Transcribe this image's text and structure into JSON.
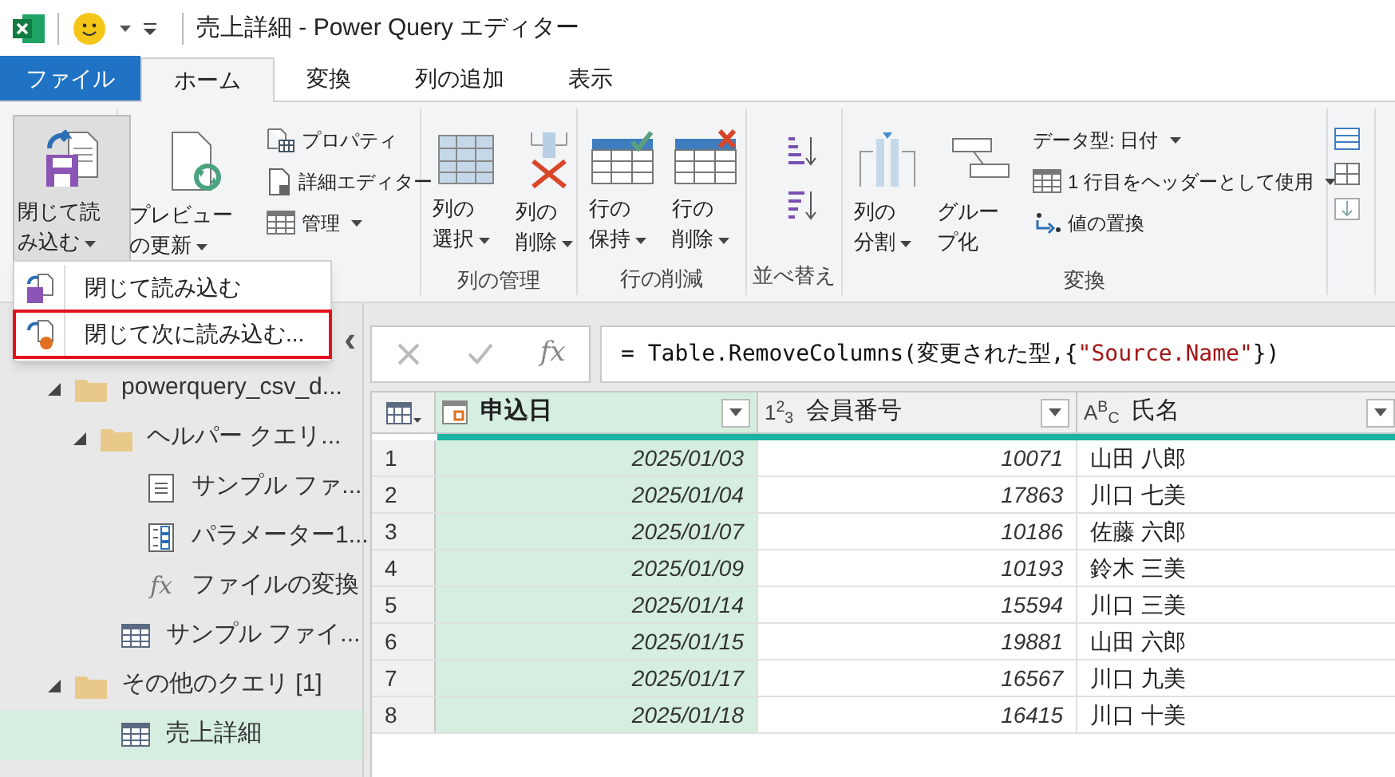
{
  "window": {
    "title": "売上詳細 - Power Query エディター"
  },
  "tabs": [
    {
      "label": "ファイル",
      "kind": "file",
      "selected": false
    },
    {
      "label": "ホーム",
      "kind": "tab",
      "selected": true
    },
    {
      "label": "変換",
      "kind": "tab",
      "selected": false
    },
    {
      "label": "列の追加",
      "kind": "tab",
      "selected": false
    },
    {
      "label": "表示",
      "kind": "tab",
      "selected": false
    }
  ],
  "ribbon": {
    "groups": [
      {
        "items": [
          {
            "kind": "large",
            "label": "閉じて読み込む",
            "dropdown": true,
            "pressed": true
          }
        ]
      },
      {
        "items": [
          {
            "kind": "large",
            "label": "プレビューの更新",
            "dropdown": true,
            "pressed": false
          },
          {
            "kind": "stack",
            "entries": [
              {
                "label": "プロパティ",
                "dropdown": false
              },
              {
                "label": "詳細エディター",
                "dropdown": false
              },
              {
                "label": "管理",
                "dropdown": true
              }
            ]
          }
        ]
      },
      {
        "label": "列の管理",
        "items": [
          {
            "kind": "large",
            "label": "列の選択",
            "dropdown": true,
            "pressed": false
          },
          {
            "kind": "large",
            "label": "列の削除",
            "dropdown": true,
            "pressed": false
          }
        ]
      },
      {
        "label": "行の削減",
        "items": [
          {
            "kind": "large",
            "label": "行の保持",
            "dropdown": true,
            "pressed": false
          },
          {
            "kind": "large",
            "label": "行の削除",
            "dropdown": true,
            "pressed": false
          }
        ]
      },
      {
        "label": "並べ替え",
        "items": [
          {
            "kind": "sort"
          }
        ]
      },
      {
        "label": "変換",
        "items": [
          {
            "kind": "large",
            "label": "列の分割",
            "dropdown": true,
            "pressed": false
          },
          {
            "kind": "large",
            "label": "グループ化",
            "dropdown": false,
            "pressed": false
          },
          {
            "kind": "stack",
            "entries": [
              {
                "label": "データ型: 日付",
                "dropdown": true
              },
              {
                "label": "1 行目をヘッダーとして使用",
                "dropdown": true
              },
              {
                "label": "値の置換",
                "dropdown": false
              }
            ]
          }
        ]
      },
      {
        "items": [
          {
            "kind": "partial"
          }
        ]
      }
    ]
  },
  "load_menu": {
    "items": [
      {
        "label": "閉じて読み込む",
        "highlighted": false
      },
      {
        "label": "閉じて次に読み込む...",
        "highlighted": true
      }
    ]
  },
  "queries_pane": {
    "collapse": "‹",
    "tree": [
      {
        "kind": "folder",
        "label": "powerquery_csv_d...",
        "expanded": true,
        "selected": false,
        "children": [
          {
            "kind": "folder",
            "label": "ヘルパー クエリ...",
            "expanded": true,
            "selected": false,
            "children": [
              {
                "kind": "list",
                "label": "サンプル ファ...",
                "selected": false
              },
              {
                "kind": "parameter",
                "label": "パラメーター1...",
                "selected": false
              },
              {
                "kind": "function",
                "icon_text": "fx",
                "label": "ファイルの変換",
                "selected": false
              }
            ]
          },
          {
            "kind": "table",
            "label": "サンプル ファイ...",
            "selected": false
          }
        ]
      },
      {
        "kind": "folder",
        "label": "その他のクエリ [1]",
        "expanded": true,
        "selected": false,
        "children": [
          {
            "kind": "table",
            "label": "売上詳細",
            "selected": true
          }
        ]
      }
    ]
  },
  "formula_bar": {
    "fx": "fx",
    "parts": [
      {
        "kind": "code",
        "text": "= Table.RemoveColumns(変更された型,{"
      },
      {
        "kind": "string",
        "text": "\"Source.Name\""
      },
      {
        "kind": "code",
        "text": "})"
      }
    ]
  },
  "table": {
    "columns": [
      {
        "kind": "date",
        "label": "申込日",
        "selected": true
      },
      {
        "kind": "number",
        "type_label": "1$^{2}$$_{3}$",
        "label": "会員番号",
        "selected": false
      },
      {
        "kind": "text",
        "type_label": "A$^{B}$$_{C}$",
        "label": "氏名",
        "selected": false
      }
    ],
    "rows": [
      {
        "n": "1",
        "cells": [
          "2025/01/03",
          "10071",
          "山田 八郎"
        ]
      },
      {
        "n": "2",
        "cells": [
          "2025/01/04",
          "17863",
          "川口 七美"
        ]
      },
      {
        "n": "3",
        "cells": [
          "2025/01/07",
          "10186",
          "佐藤 六郎"
        ]
      },
      {
        "n": "4",
        "cells": [
          "2025/01/09",
          "10193",
          "鈴木 三美"
        ]
      },
      {
        "n": "5",
        "cells": [
          "2025/01/14",
          "15594",
          "川口 三美"
        ]
      },
      {
        "n": "6",
        "cells": [
          "2025/01/15",
          "19881",
          "山田 六郎"
        ]
      },
      {
        "n": "7",
        "cells": [
          "2025/01/17",
          "16567",
          "川口 九美"
        ]
      },
      {
        "n": "8",
        "cells": [
          "2025/01/18",
          "16415",
          "川口 十美"
        ]
      }
    ]
  }
}
